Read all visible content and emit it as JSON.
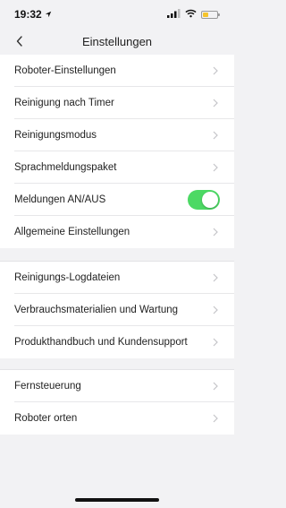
{
  "status_bar": {
    "time": "19:32",
    "battery_color": "#f5c42c"
  },
  "nav": {
    "title": "Einstellungen",
    "back_icon": "chevron-left-icon"
  },
  "sections": [
    {
      "items": [
        {
          "label": "Roboter-Einstellungen",
          "control": "chevron"
        },
        {
          "label": "Reinigung nach Timer",
          "control": "chevron"
        },
        {
          "label": "Reinigungsmodus",
          "control": "chevron"
        },
        {
          "label": "Sprachmeldungspaket",
          "control": "chevron"
        },
        {
          "label": "Meldungen AN/AUS",
          "control": "toggle",
          "toggle_on": true
        },
        {
          "label": "Allgemeine Einstellungen",
          "control": "chevron"
        }
      ]
    },
    {
      "items": [
        {
          "label": "Reinigungs-Logdateien",
          "control": "chevron"
        },
        {
          "label": "Verbrauchsmaterialien und Wartung",
          "control": "chevron"
        },
        {
          "label": "Produkthandbuch und Kundensupport",
          "control": "chevron"
        }
      ]
    },
    {
      "items": [
        {
          "label": "Fernsteuerung",
          "control": "chevron"
        },
        {
          "label": "Roboter orten",
          "control": "chevron"
        }
      ]
    }
  ],
  "colors": {
    "toggle_on": "#4cd964",
    "background": "#f2f2f4",
    "chevron": "#c4c4c8"
  }
}
